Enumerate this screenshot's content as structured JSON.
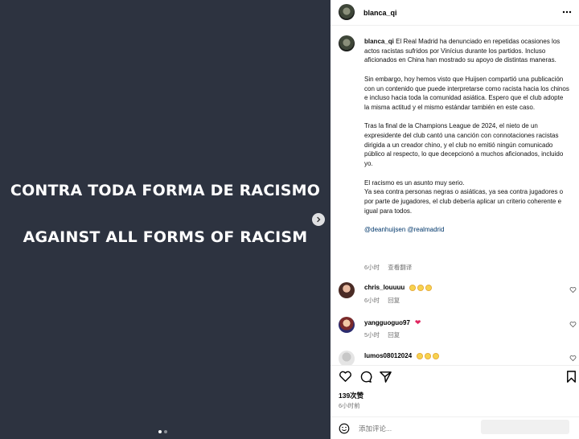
{
  "media": {
    "line1": "CONTRA TODA FORMA DE RACISMO",
    "line2": "AGAINST ALL FORMS OF RACISM",
    "carousel": {
      "count": 2,
      "current": 1
    }
  },
  "header": {
    "username": "blanca_qi"
  },
  "caption": {
    "username": "blanca_qi",
    "paragraph1": "El Real Madrid ha denunciado en repetidas ocasiones los actos racistas sufridos por Vinícius durante los partidos. Incluso aficionados en China han mostrado su apoyo de distintas maneras.",
    "paragraph2": "Sin embargo, hoy hemos visto que Huijsen compartió una publicación con un contenido que puede interpretarse como racista hacia los chinos e incluso hacia toda la comunidad asiática. Espero que el club adopte la misma actitud y el mismo estándar también en este caso.",
    "paragraph3": "Tras la final de la Champions League de 2024, el nieto de un expresidente del club cantó una canción con connotaciones racistas dirigida a un creador chino, y el club no emitió ningún comunicado público al respecto, lo que decepcionó a muchos aficionados, incluido yo.",
    "paragraph4": "El racismo es un asunto muy serio.\nYa sea contra personas negras o asiáticas, ya sea contra jugadores o por parte de jugadores, el club debería aplicar un criterio coherente e igual para todos.",
    "mentions": "@deanhuijsen @realmadrid",
    "time": "6小时",
    "translate": "查看翻译"
  },
  "comments": [
    {
      "username": "chris_louuuu",
      "emoji": "clap-clap-clap",
      "time": "6小时",
      "reply": "回复"
    },
    {
      "username": "yangguoguo97",
      "emoji_text": "❤",
      "time": "5小时",
      "reply": "回复"
    },
    {
      "username": "lumos08012024",
      "emoji": "clap-clap-clap"
    }
  ],
  "footer": {
    "likes": "139次赞",
    "time": "6小时前",
    "comment_placeholder": "添加评论..."
  },
  "colors": {
    "media_bg": "#2d3340",
    "link": "#00376b",
    "heart": "#e0245e"
  }
}
